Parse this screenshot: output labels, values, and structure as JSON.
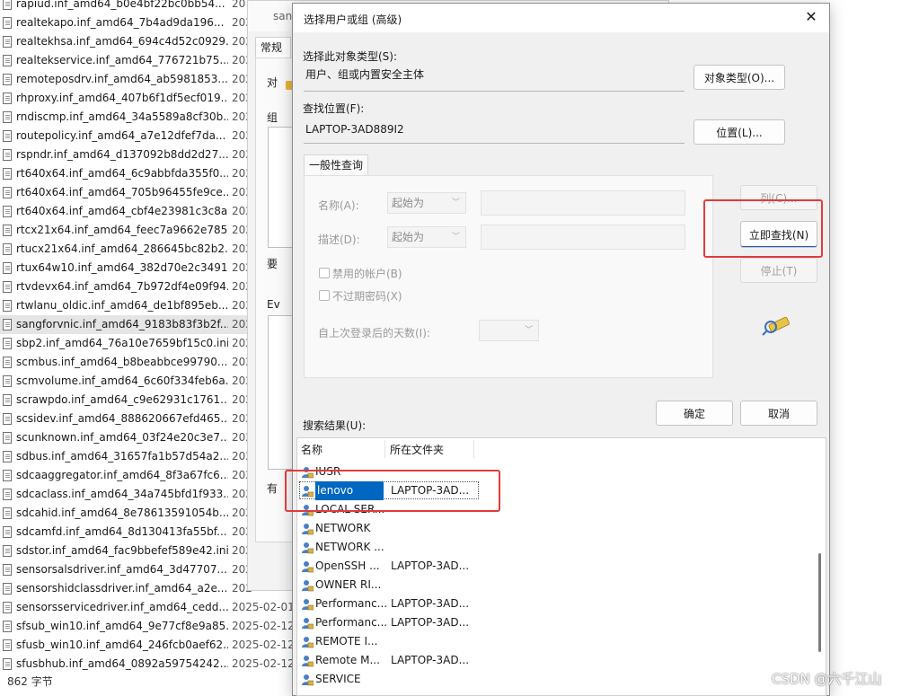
{
  "explorer": {
    "files": [
      {
        "name": "rapiud.inf_amd64_b0e4bf22bc0bb54...",
        "date": "20"
      },
      {
        "name": "realtekapo.inf_amd64_7b4ad9da196...",
        "date": "202"
      },
      {
        "name": "realtekhsa.inf_amd64_694c4d52c0929...",
        "date": "202"
      },
      {
        "name": "realtekservice.inf_amd64_776721b75...",
        "date": "202"
      },
      {
        "name": "remoteposdrv.inf_amd64_ab5981853...",
        "date": "202"
      },
      {
        "name": "rhproxy.inf_amd64_407b6f1df5ecf019...",
        "date": "202"
      },
      {
        "name": "rndiscmp.inf_amd64_34a5589a8cf30b...",
        "date": "202"
      },
      {
        "name": "routepolicy.inf_amd64_a7e12dfef7da...",
        "date": "202"
      },
      {
        "name": "rspndr.inf_amd64_d137092b8dd2d27...",
        "date": "202"
      },
      {
        "name": "rt640x64.inf_amd64_6c9abbfda355f0...",
        "date": "202"
      },
      {
        "name": "rt640x64.inf_amd64_705b96455fe9ce...",
        "date": "202"
      },
      {
        "name": "rt640x64.inf_amd64_cbf4e23981c3c8a...",
        "date": "202"
      },
      {
        "name": "rtcx21x64.inf_amd64_feec7a9662e785...",
        "date": "202"
      },
      {
        "name": "rtucx21x64.inf_amd64_286645bc82b2...",
        "date": "202"
      },
      {
        "name": "rtux64w10.inf_amd64_382d70e2c3491...",
        "date": "202"
      },
      {
        "name": "rtvdevx64.inf_amd64_7b972df4e09f94...",
        "date": "202"
      },
      {
        "name": "rtwlanu_oldic.inf_amd64_de1bf895eb...",
        "date": "202"
      },
      {
        "name": "sangforvnic.inf_amd64_9183b83f3b2f...",
        "date": "202"
      },
      {
        "name": "sbp2.inf_amd64_76a10e7659bf15c0.ini",
        "date": "202"
      },
      {
        "name": "scmbus.inf_amd64_b8beabbce99790...",
        "date": "202"
      },
      {
        "name": "scmvolume.inf_amd64_6c60f334feb6a...",
        "date": "202"
      },
      {
        "name": "scrawpdo.inf_amd64_c9e62931c1761...",
        "date": "202"
      },
      {
        "name": "scsidev.inf_amd64_888620667efd465...",
        "date": "202"
      },
      {
        "name": "scunknown.inf_amd64_03f24e20c3e7...",
        "date": "202"
      },
      {
        "name": "sdbus.inf_amd64_31657fa1b57d54a2...",
        "date": "202"
      },
      {
        "name": "sdcaaggregator.inf_amd64_8f3a67fc6...",
        "date": "202"
      },
      {
        "name": "sdcaclass.inf_amd64_34a745bfd1f933...",
        "date": "202"
      },
      {
        "name": "sdcahid.inf_amd64_8e78613591054b...",
        "date": "202"
      },
      {
        "name": "sdcamfd.inf_amd64_8d130413fa55bf...",
        "date": "202"
      },
      {
        "name": "sdstor.inf_amd64_fac9bbefef589e42.ini",
        "date": "202"
      },
      {
        "name": "sensorsalsdriver.inf_amd64_3d47707...",
        "date": "202"
      },
      {
        "name": "sensorshidclassdriver.inf_amd64_a2e...",
        "date": "202"
      },
      {
        "name": "sensorsservicedriver.inf_amd64_cedd...",
        "date": "2025-02-01"
      },
      {
        "name": "sfsub_win10.inf_amd64_9e77cf8e9a85...",
        "date": "2025-02-12"
      },
      {
        "name": "sfusb_win10.inf_amd64_246fcb0aef62...",
        "date": "2025-02-12"
      },
      {
        "name": "sfusbhub.inf_amd64_0892a59754242...",
        "date": "2025-02-12"
      }
    ],
    "selected_index": 17,
    "status": "862 字节"
  },
  "props_window": {
    "title": "sang",
    "tab": "常规",
    "label_1": "对",
    "label_2": "组",
    "label_3": "要",
    "label_4": "Ev",
    "label_5": "有"
  },
  "dialog": {
    "title": "选择用户或组 (高级)",
    "close_glyph": "✕",
    "object_type_label": "选择此对象类型(S):",
    "object_type_value": "用户、组或内置安全主体",
    "object_type_button": "对象类型(O)...",
    "location_label": "查找位置(F):",
    "location_value": "LAPTOP-3AD889I2",
    "location_button": "位置(L)...",
    "tab_label": "一般性查询",
    "name_label": "名称(A):",
    "name_mode": "起始为",
    "desc_label": "描述(D):",
    "desc_mode": "起始为",
    "disabled_accounts": "禁用的帐户(B)",
    "no_expire_password": "不过期密码(X)",
    "days_since_login": "自上次登录后的天数(I):",
    "columns_button": "列(C)...",
    "find_now_button": "立即查找(N)",
    "stop_button": "停止(T)",
    "ok_button": "确定",
    "cancel_button": "取消",
    "results_label": "搜索结果(U):",
    "col_name": "名称",
    "col_folder": "所在文件夹",
    "results": [
      {
        "name": "IUSR",
        "folder": ""
      },
      {
        "name": "lenovo",
        "folder": "LAPTOP-3AD..."
      },
      {
        "name": "LOCAL SER...",
        "folder": ""
      },
      {
        "name": "NETWORK",
        "folder": ""
      },
      {
        "name": "NETWORK ...",
        "folder": ""
      },
      {
        "name": "OpenSSH ...",
        "folder": "LAPTOP-3AD..."
      },
      {
        "name": "OWNER RI...",
        "folder": ""
      },
      {
        "name": "Performanc...",
        "folder": "LAPTOP-3AD..."
      },
      {
        "name": "Performanc...",
        "folder": "LAPTOP-3AD..."
      },
      {
        "name": "REMOTE I...",
        "folder": ""
      },
      {
        "name": "Remote M...",
        "folder": "LAPTOP-3AD..."
      },
      {
        "name": "SERVICE",
        "folder": ""
      }
    ],
    "selected_result_index": 1
  },
  "watermark": "CSDN @六千江山",
  "colors": {
    "highlight_box": "#e23b3b",
    "selection": "#0067c0"
  }
}
